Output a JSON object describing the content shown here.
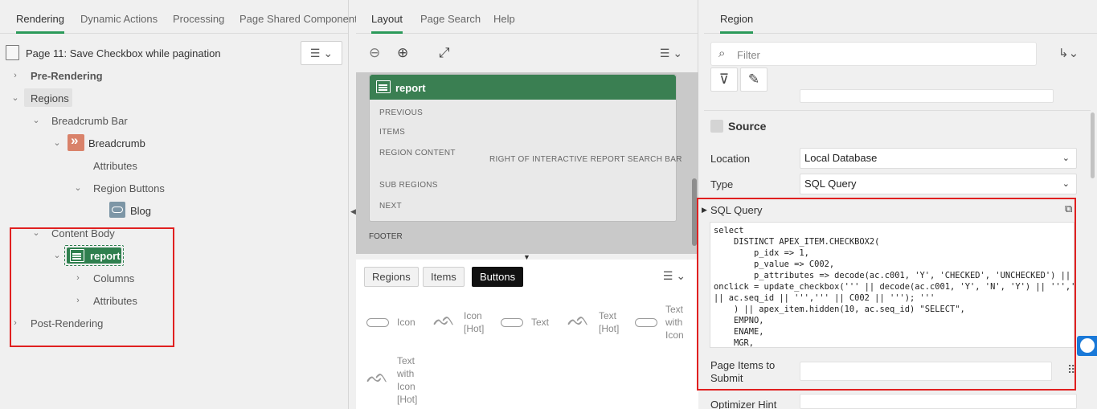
{
  "left": {
    "tabs": [
      "Rendering",
      "Dynamic Actions",
      "Processing",
      "Page Shared Component"
    ],
    "page_title": "Page 11: Save Checkbox while pagination",
    "tree": {
      "pre_rendering": "Pre-Rendering",
      "regions": "Regions",
      "breadcrumb_bar": "Breadcrumb Bar",
      "breadcrumb": "Breadcrumb",
      "attributes": "Attributes",
      "region_buttons": "Region Buttons",
      "blog": "Blog",
      "content_body": "Content Body",
      "report": "report",
      "columns": "Columns",
      "attributes2": "Attributes",
      "post_rendering": "Post-Rendering"
    }
  },
  "mid": {
    "tabs": [
      "Layout",
      "Page Search",
      "Help"
    ],
    "report_title": "report",
    "slots": {
      "previous": "PREVIOUS",
      "items": "ITEMS",
      "region_content": "REGION CONTENT",
      "right_of_search": "RIGHT OF INTERACTIVE REPORT SEARCH BAR",
      "sub_regions": "SUB REGIONS",
      "next": "NEXT",
      "footer": "FOOTER"
    },
    "gallery_tabs": [
      "Regions",
      "Items",
      "Buttons"
    ],
    "gallery_items": {
      "icon": "Icon",
      "icon_hot_1": "Icon",
      "icon_hot_2": "[Hot]",
      "text": "Text",
      "text_hot_1": "Text",
      "text_hot_2": "[Hot]",
      "twi_1": "Text",
      "twi_2": "with",
      "twi_3": "Icon",
      "twih_1": "Text",
      "twih_2": "with",
      "twih_3": "Icon",
      "twih_4": "[Hot]"
    }
  },
  "right": {
    "tab": "Region",
    "filter_placeholder": "Filter",
    "section": "Source",
    "location_label": "Location",
    "location_value": "Local Database",
    "type_label": "Type",
    "type_value": "SQL Query",
    "sql_label": "SQL Query",
    "sql_code": "select\n    DISTINCT APEX_ITEM.CHECKBOX2(\n        p_idx => 1,\n        p_value => C002,\n        p_attributes => decode(ac.c001, 'Y', 'CHECKED', 'UNCHECKED') || '\nonclick = update_checkbox(''' || decode(ac.c001, 'Y', 'N', 'Y') || ''','''\n|| ac.seq_id || ''',''' || C002 || '''); '''\n    ) || apex_item.hidden(10, ac.seq_id) \"SELECT\",\n    EMPNO,\n    ENAME,\n    MGR,",
    "page_items_label_1": "Page Items to",
    "page_items_label_2": "Submit",
    "optimizer_label": "Optimizer Hint"
  },
  "colors": {
    "accent_green": "#2b9a5a",
    "report_green": "#3a7f52",
    "highlight_red": "#e02020"
  }
}
